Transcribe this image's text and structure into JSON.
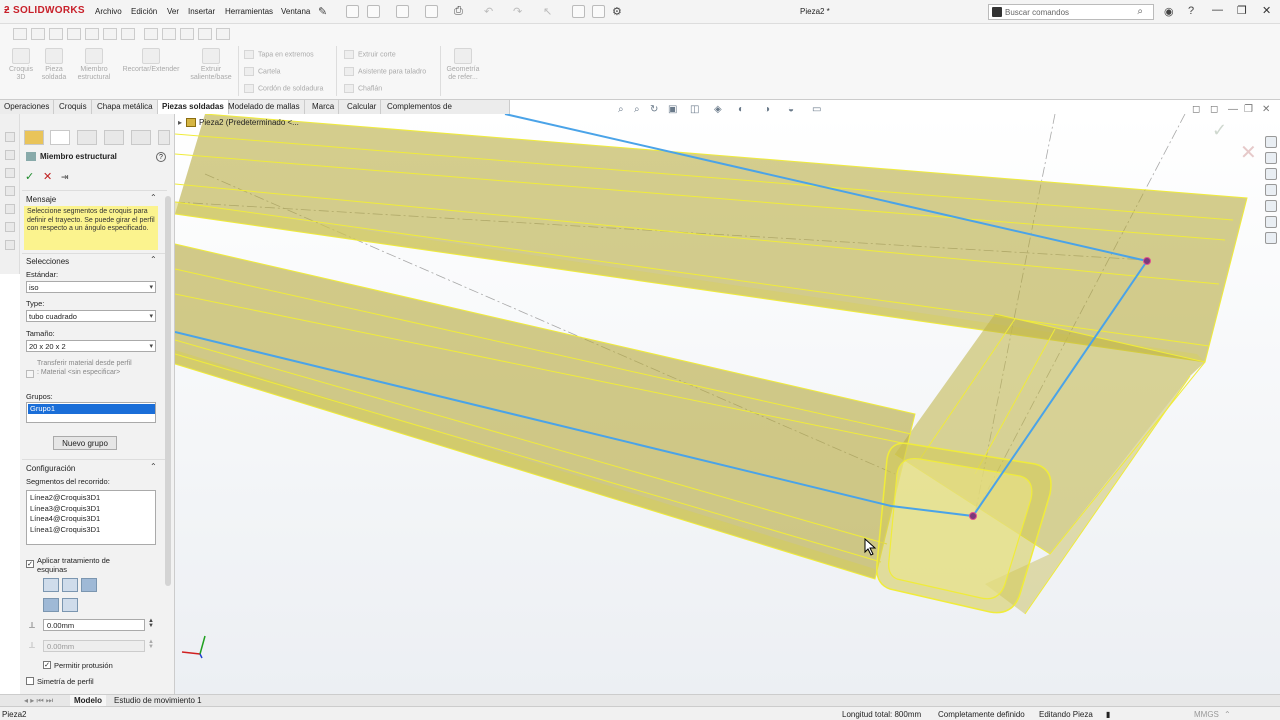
{
  "app": {
    "logo": "SOLIDWORKS",
    "document_title": "Pieza2 *"
  },
  "menu": [
    "Archivo",
    "Edición",
    "Ver",
    "Insertar",
    "Herramientas",
    "Ventana"
  ],
  "search": {
    "placeholder": "Buscar comandos"
  },
  "ribbon": {
    "col1": [
      {
        "label": "Croquis 3D"
      },
      {
        "label": "Pieza soldada"
      },
      {
        "label": "Miembro estructural"
      },
      {
        "label": "Recortar/Extender"
      },
      {
        "label": "Extruir saliente/base"
      }
    ],
    "col2": [
      "Tapa en extremos",
      "Cartela",
      "Cordón de soldadura"
    ],
    "col3": [
      "Extruir corte",
      "Asistente para taladro",
      "Chaflán"
    ],
    "col4": {
      "label": "Geometría de refer..."
    }
  },
  "tabs": [
    "Operaciones",
    "Croquis",
    "Chapa metálica",
    "Piezas soldadas",
    "Modelado de mallas",
    "Marca",
    "Calcular",
    "Complementos de SOLIDWORKS"
  ],
  "active_tab": "Piezas soldadas",
  "tree": {
    "part": "Pieza2  (Predeterminado <..."
  },
  "property_manager": {
    "title": "Miembro estructural",
    "mensaje": {
      "header": "Mensaje",
      "text": "Seleccione segmentos de croquis para definir el trayecto. Se puede girar el perfil con respecto a un ángulo especificado."
    },
    "selecciones": {
      "header": "Selecciones",
      "estandar_label": "Estándar:",
      "estandar_value": "iso",
      "type_label": "Type:",
      "type_value": "tubo cuadrado",
      "tamano_label": "Tamaño:",
      "tamano_value": "20 x 20 x 2",
      "transfer_text": "Transferir material desde perfil : Material <sin especificar>",
      "grupos_label": "Grupos:",
      "grupo_item": "Grupo1",
      "new_group": "Nuevo grupo"
    },
    "configuracion": {
      "header": "Configuración",
      "segmentos_label": "Segmentos del recorrido:",
      "segmentos": [
        "Línea2@Croquis3D1",
        "Línea3@Croquis3D1",
        "Línea4@Croquis3D1",
        "Línea1@Croquis3D1"
      ],
      "corner_label": "Aplicar tratamiento de esquinas",
      "gap1": "0.00mm",
      "gap2": "0.00mm",
      "permitir": "Permitir protusión",
      "simetria": "Simetría de perfil"
    }
  },
  "bottom_tabs": [
    "Modelo",
    "Estudio de movimiento 1"
  ],
  "status": {
    "left": "Pieza2",
    "longitud": "Longitud total: 800mm",
    "definido": "Completamente definido",
    "editando": "Editando Pieza",
    "units": "MMGS"
  },
  "colors": {
    "tube_fill": "#b5a83a",
    "tube_edge": "#f0ec3a",
    "sketch": "#4aa3e8",
    "message_bg": "#fbf38e",
    "selection": "#1a6ed8"
  }
}
